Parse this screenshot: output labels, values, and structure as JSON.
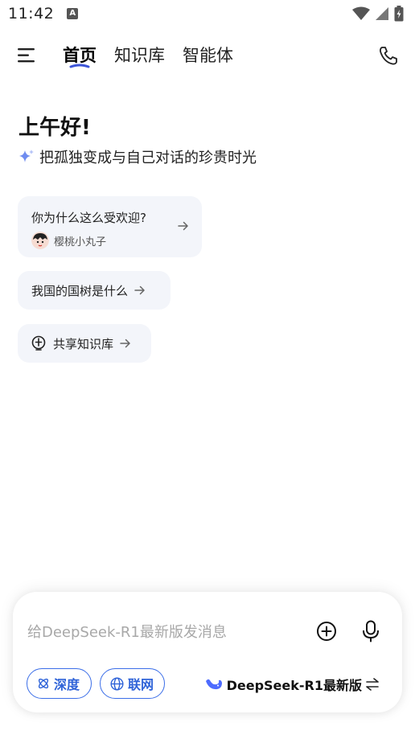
{
  "status_bar": {
    "time": "11:42",
    "notification_icon": "a-icon"
  },
  "nav": {
    "tabs": [
      {
        "label": "首页",
        "active": true
      },
      {
        "label": "知识库",
        "active": false
      },
      {
        "label": "智能体",
        "active": false
      }
    ]
  },
  "home": {
    "greeting": "上午好!",
    "subtitle": "把孤独变成与自己对话的珍贵时光",
    "suggestions": [
      {
        "question": "你为什么这么受欢迎?",
        "author": "樱桃小丸子"
      },
      {
        "question": "我国的国树是什么"
      },
      {
        "question": "共享知识库"
      }
    ]
  },
  "composer": {
    "placeholder": "给DeepSeek-R1最新版发消息",
    "deep_label": "深度",
    "web_label": "联网",
    "model_label": "DeepSeek-R1最新版"
  },
  "colors": {
    "accent": "#3b6ee8",
    "card_bg": "#f3f5fa",
    "tab_underline": "#3d55d8"
  }
}
